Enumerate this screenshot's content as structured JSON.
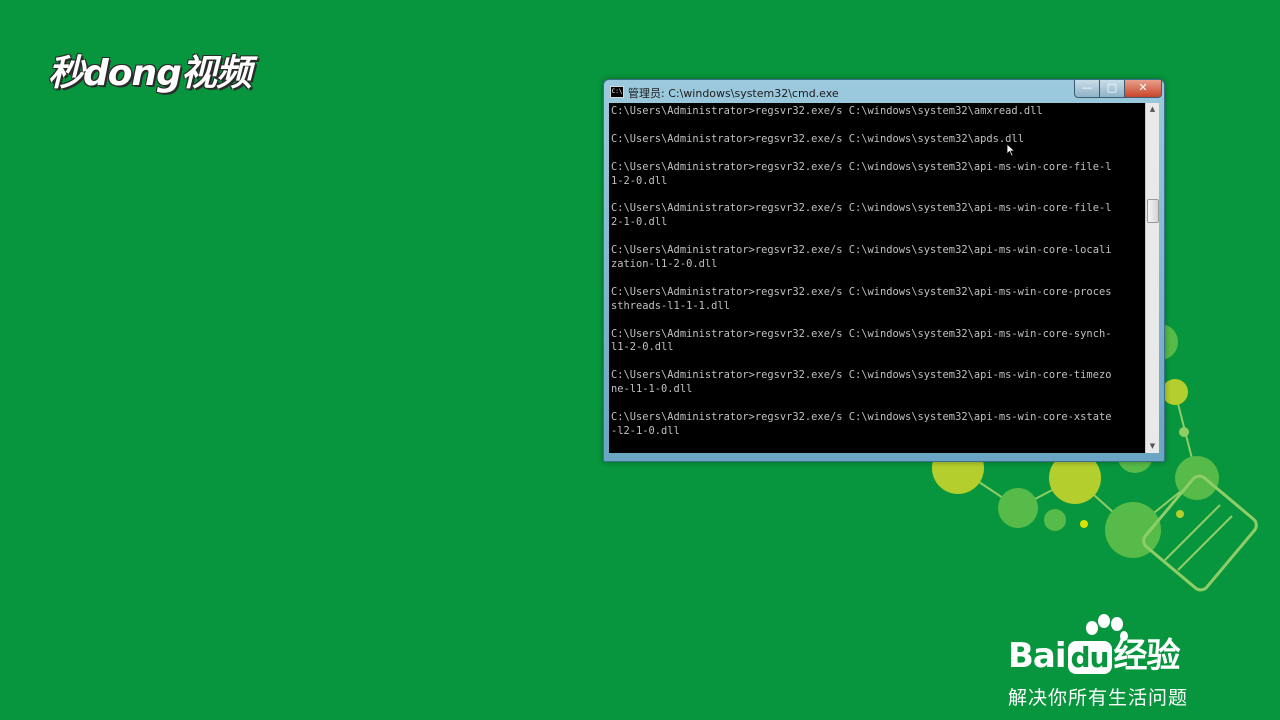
{
  "watermark": {
    "logo_text": "秒dong视频"
  },
  "window": {
    "title": "管理员: C:\\windows\\system32\\cmd.exe",
    "icon": "cmd-icon",
    "buttons": {
      "minimize": "—",
      "maximize": "□",
      "close": "✕"
    }
  },
  "console": {
    "lines": [
      "C:\\Users\\Administrator>regsvr32.exe/s C:\\windows\\system32\\amxread.dll",
      "",
      "C:\\Users\\Administrator>regsvr32.exe/s C:\\windows\\system32\\apds.dll",
      "",
      "C:\\Users\\Administrator>regsvr32.exe/s C:\\windows\\system32\\api-ms-win-core-file-l",
      "1-2-0.dll",
      "",
      "C:\\Users\\Administrator>regsvr32.exe/s C:\\windows\\system32\\api-ms-win-core-file-l",
      "2-1-0.dll",
      "",
      "C:\\Users\\Administrator>regsvr32.exe/s C:\\windows\\system32\\api-ms-win-core-locali",
      "zation-l1-2-0.dll",
      "",
      "C:\\Users\\Administrator>regsvr32.exe/s C:\\windows\\system32\\api-ms-win-core-proces",
      "sthreads-l1-1-1.dll",
      "",
      "C:\\Users\\Administrator>regsvr32.exe/s C:\\windows\\system32\\api-ms-win-core-synch-",
      "l1-2-0.dll",
      "",
      "C:\\Users\\Administrator>regsvr32.exe/s C:\\windows\\system32\\api-ms-win-core-timezo",
      "ne-l1-1-0.dll",
      "",
      "C:\\Users\\Administrator>regsvr32.exe/s C:\\windows\\system32\\api-ms-win-core-xstate",
      "-l2-1-0.dll"
    ]
  },
  "scrollbar": {
    "up_arrow": "▲",
    "down_arrow": "▼"
  },
  "brand": {
    "name_prefix": "Bai",
    "name_du": "du",
    "name_suffix": "经验",
    "tagline": "解决你所有生活问题"
  },
  "colors": {
    "background": "#07963d",
    "console_bg": "#000000",
    "console_text": "#c0c0c0",
    "titlebar": "#9cc9dd"
  }
}
